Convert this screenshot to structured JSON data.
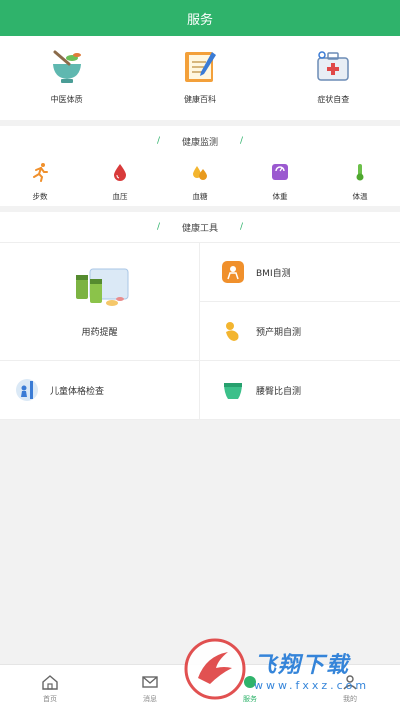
{
  "header": {
    "title": "服务"
  },
  "top_services": [
    {
      "label": "中医体质",
      "icon": "mortar-herb-icon"
    },
    {
      "label": "健康百科",
      "icon": "notebook-icon"
    },
    {
      "label": "症状自查",
      "icon": "medical-kit-icon"
    }
  ],
  "monitor": {
    "title": "健康监测",
    "items": [
      {
        "label": "步数",
        "icon": "running-icon"
      },
      {
        "label": "血压",
        "icon": "blood-drop-icon"
      },
      {
        "label": "血糖",
        "icon": "sugar-drops-icon"
      },
      {
        "label": "体重",
        "icon": "scale-icon"
      },
      {
        "label": "体温",
        "icon": "thermometer-icon"
      }
    ]
  },
  "tools": {
    "title": "健康工具",
    "medication": {
      "label": "用药提醒",
      "icon": "pill-bottles-icon"
    },
    "bmi": {
      "label": "BMI自测",
      "icon": "bmi-scale-icon"
    },
    "due_date": {
      "label": "预产期自测",
      "icon": "baby-icon"
    },
    "child_exam": {
      "label": "儿童体格检查",
      "icon": "child-height-icon"
    },
    "waist_hip": {
      "label": "腰臀比自测",
      "icon": "waist-icon"
    }
  },
  "bottom_nav": [
    {
      "label": "首页",
      "icon": "home-icon",
      "active": false
    },
    {
      "label": "消息",
      "icon": "mail-icon",
      "active": false
    },
    {
      "label": "服务",
      "icon": "service-icon",
      "active": true
    },
    {
      "label": "我的",
      "icon": "profile-icon",
      "active": false
    }
  ],
  "watermark": {
    "main": "飞翔下载",
    "sub": "www.fxxz.com"
  },
  "colors": {
    "accent": "#2fb36b",
    "background": "#f2f2f2"
  }
}
